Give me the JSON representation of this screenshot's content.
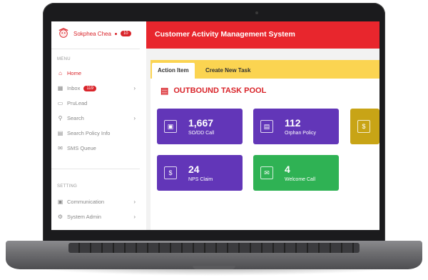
{
  "user": {
    "name": "Sokphea Chea",
    "notifications": "10"
  },
  "menu": {
    "label": "MENU",
    "items": [
      {
        "icon": "home-icon",
        "label": "Home"
      },
      {
        "icon": "inbox-icon",
        "label": "Inbox",
        "badge": "119"
      },
      {
        "icon": "file-icon",
        "label": "PruLead"
      },
      {
        "icon": "search-icon",
        "label": "Search"
      },
      {
        "icon": "document-icon",
        "label": "Search Policy Info"
      },
      {
        "icon": "message-icon",
        "label": "SMS Queue"
      }
    ]
  },
  "settings": {
    "label": "SETTING",
    "items": [
      {
        "icon": "communication-icon",
        "label": "Communication"
      },
      {
        "icon": "admin-icon",
        "label": "System Admin"
      }
    ]
  },
  "header": {
    "title": "Customer Activity Management System"
  },
  "tabs": [
    {
      "label": "Action Item",
      "active": true
    },
    {
      "label": "Create New Task",
      "active": false
    }
  ],
  "pool": {
    "title": "OUTBOUND TASK POOL"
  },
  "cards": [
    {
      "value": "1,667",
      "label": "SO/DD Call",
      "color": "#6236b8"
    },
    {
      "value": "112",
      "label": "Orphan Policy",
      "color": "#6236b8"
    },
    {
      "value": "",
      "label": "",
      "color": "#c8a416"
    },
    {
      "value": "24",
      "label": "NPS Claim",
      "color": "#6236b8"
    },
    {
      "value": "4",
      "label": "Welcome Call",
      "color": "#2fb254"
    }
  ],
  "colors": {
    "brand_red": "#e8262d",
    "tab_yellow": "#fbd451"
  }
}
